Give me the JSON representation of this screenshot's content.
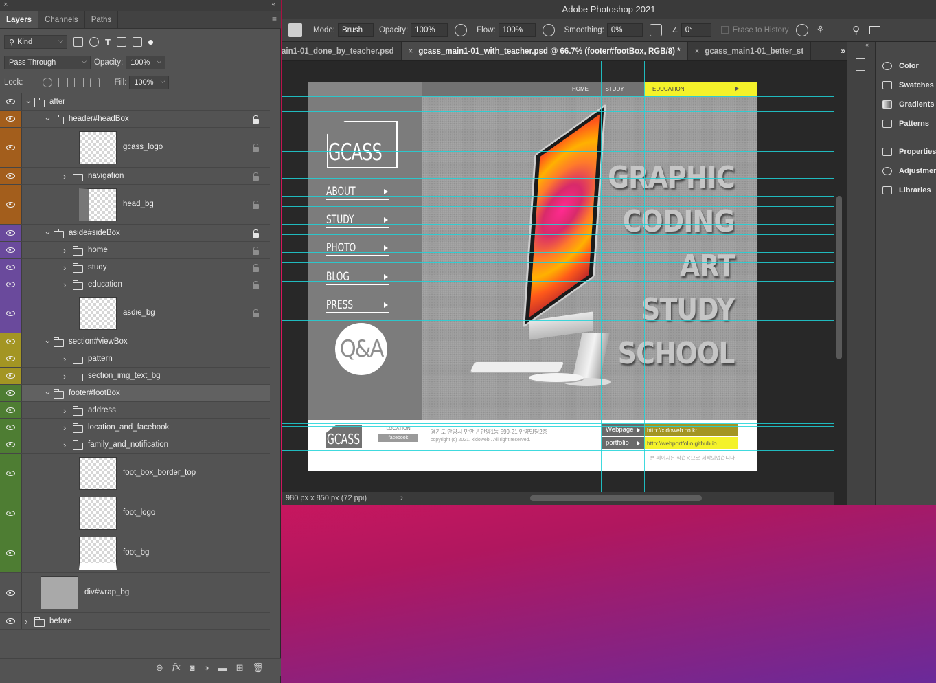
{
  "layers_panel": {
    "tabs": [
      "Layers",
      "Channels",
      "Paths"
    ],
    "filter_kind": "Kind",
    "blend_mode": "Pass Through",
    "opacity_label": "Opacity:",
    "opacity_value": "100%",
    "lock_label": "Lock:",
    "fill_label": "Fill:",
    "fill_value": "100%",
    "colors": {
      "orange": "#a35e1c",
      "purple": "#6a4a9c",
      "yellow": "#a39523",
      "green": "#4e7d33"
    },
    "layers": [
      {
        "name": "after"
      },
      {
        "name": "header#headBox"
      },
      {
        "name": "gcass_logo"
      },
      {
        "name": "navigation"
      },
      {
        "name": "head_bg"
      },
      {
        "name": "aside#sideBox"
      },
      {
        "name": "home"
      },
      {
        "name": "study"
      },
      {
        "name": "education"
      },
      {
        "name": "asdie_bg"
      },
      {
        "name": "section#viewBox"
      },
      {
        "name": "pattern"
      },
      {
        "name": "section_img_text_bg"
      },
      {
        "name": "footer#footBox"
      },
      {
        "name": "address"
      },
      {
        "name": "location_and_facebook"
      },
      {
        "name": "family_and_notification"
      },
      {
        "name": "foot_box_border_top"
      },
      {
        "name": "foot_logo"
      },
      {
        "name": "foot_bg"
      },
      {
        "name": "div#wrap_bg"
      },
      {
        "name": "before"
      }
    ],
    "bottom_icons": [
      "link-icon",
      "fx-icon",
      "mask-icon",
      "adjustment-icon",
      "group-icon",
      "new-layer-icon",
      "trash-icon"
    ]
  },
  "app": {
    "title": "Adobe Photoshop 2021",
    "options": {
      "mode_label": "Mode:",
      "mode_value": "Brush",
      "opacity_label": "Opacity:",
      "opacity_value": "100%",
      "flow_label": "Flow:",
      "flow_value": "100%",
      "smoothing_label": "Smoothing:",
      "smoothing_value": "0%",
      "angle_value": "0°",
      "erase_label": "Erase to History"
    },
    "doc_tabs": [
      "ain1-01_done_by_teacher.psd",
      "gcass_main1-01_with_teacher.psd @ 66.7% (footer#footBox, RGB/8) *",
      "gcass_main1-01_better_st"
    ],
    "status": "980 px x 850 px (72 ppi)",
    "right_panels": [
      "Color",
      "Swatches",
      "Gradients",
      "Patterns",
      "Properties",
      "Adjustments",
      "Libraries"
    ]
  },
  "document": {
    "nav": [
      "HOME",
      "STUDY",
      "EDUCATION"
    ],
    "logo": "GCASS",
    "menu": [
      "ABOUT",
      "STUDY",
      "PHOTO",
      "BLOG",
      "PRESS"
    ],
    "qa": "Q&A",
    "words": [
      "GRAPHIC",
      "CODING",
      "ART",
      "STUDY",
      "SCHOOL"
    ],
    "footer": {
      "logo": "GCASS",
      "location": "LOCATION",
      "facebook": "facebook",
      "address": "경기도 안양시 만안구 안양1동 599-21 안양빌딩2층",
      "copyright": "copyright (c) 2021. xidoweb . All right reserved.",
      "webpage_label": "Webpage",
      "webpage_url": "http://xidoweb.co.kr",
      "portfolio_label": "portfolio",
      "portfolio_url": "http://webportfolio.github.io",
      "notice": "본 페이지는 학습용으로 제작되었습니다"
    },
    "colors": {
      "accent_yellow": "#f4f22a",
      "link_olive": "#a39523"
    }
  }
}
